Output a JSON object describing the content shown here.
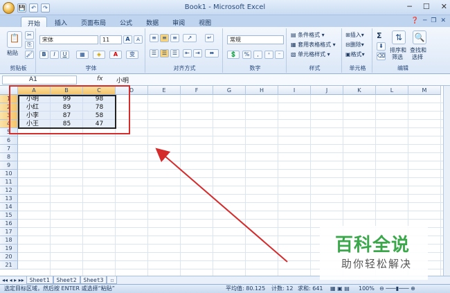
{
  "window": {
    "title": "Book1 - Microsoft Excel",
    "controls": [
      "─",
      "☐",
      "✕"
    ]
  },
  "qat": {
    "save": "💾",
    "undo": "↶",
    "redo": "↷"
  },
  "tabs": [
    {
      "label": "开始",
      "active": true
    },
    {
      "label": "插入"
    },
    {
      "label": "页面布局"
    },
    {
      "label": "公式"
    },
    {
      "label": "数据"
    },
    {
      "label": "审阅"
    },
    {
      "label": "视图"
    }
  ],
  "ribbon": {
    "clipboard": {
      "label": "剪贴板",
      "paste": "粘贴"
    },
    "font": {
      "label": "字体",
      "name": "宋体",
      "size": "11",
      "bold": "B",
      "italic": "I",
      "underline": "U",
      "grow": "A",
      "shrink": "A",
      "color_a": "A",
      "wen": "变"
    },
    "alignment": {
      "label": "对齐方式"
    },
    "number": {
      "label": "数字",
      "format": "常规",
      "percent": "%"
    },
    "styles": {
      "label": "样式",
      "cond": "条件格式",
      "table": "套用表格格式",
      "cell": "单元格样式"
    },
    "cells": {
      "label": "单元格",
      "insert": "插入",
      "delete": "删除",
      "format": "格式"
    },
    "editing": {
      "label": "编辑",
      "sigma": "Σ",
      "sort": "排序和",
      "sort2": "筛选",
      "find": "查找和",
      "find2": "选择"
    }
  },
  "formula_bar": {
    "name_box": "A1",
    "fx": "fx",
    "value": "小明"
  },
  "columns": [
    "A",
    "B",
    "C",
    "D",
    "E",
    "F",
    "G",
    "H",
    "I",
    "J",
    "K",
    "L",
    "M"
  ],
  "rows": [
    "1",
    "2",
    "3",
    "4",
    "5",
    "6",
    "7",
    "8",
    "9",
    "10",
    "11",
    "12",
    "13",
    "14",
    "15",
    "16",
    "17",
    "18",
    "19",
    "20",
    "21"
  ],
  "table": [
    {
      "name": "小明",
      "b": "99",
      "c": "98"
    },
    {
      "name": "小红",
      "b": "89",
      "c": "78"
    },
    {
      "name": "小李",
      "b": "87",
      "c": "58"
    },
    {
      "name": "小王",
      "b": "85",
      "c": "47"
    }
  ],
  "sheets": [
    "Sheet1",
    "Sheet2",
    "Sheet3"
  ],
  "status": {
    "message": "选定目标区域，然后按 ENTER 或选择“粘贴”",
    "average": "平均值: 80.125",
    "count": "计数: 12",
    "sum": "求和: 641",
    "zoom": "100%"
  },
  "watermark": {
    "line1": "百科全说",
    "line2": "助你轻松解决"
  },
  "colors": {
    "annotation_red": "#d42b2b",
    "watermark_green": "#3aa84a"
  }
}
